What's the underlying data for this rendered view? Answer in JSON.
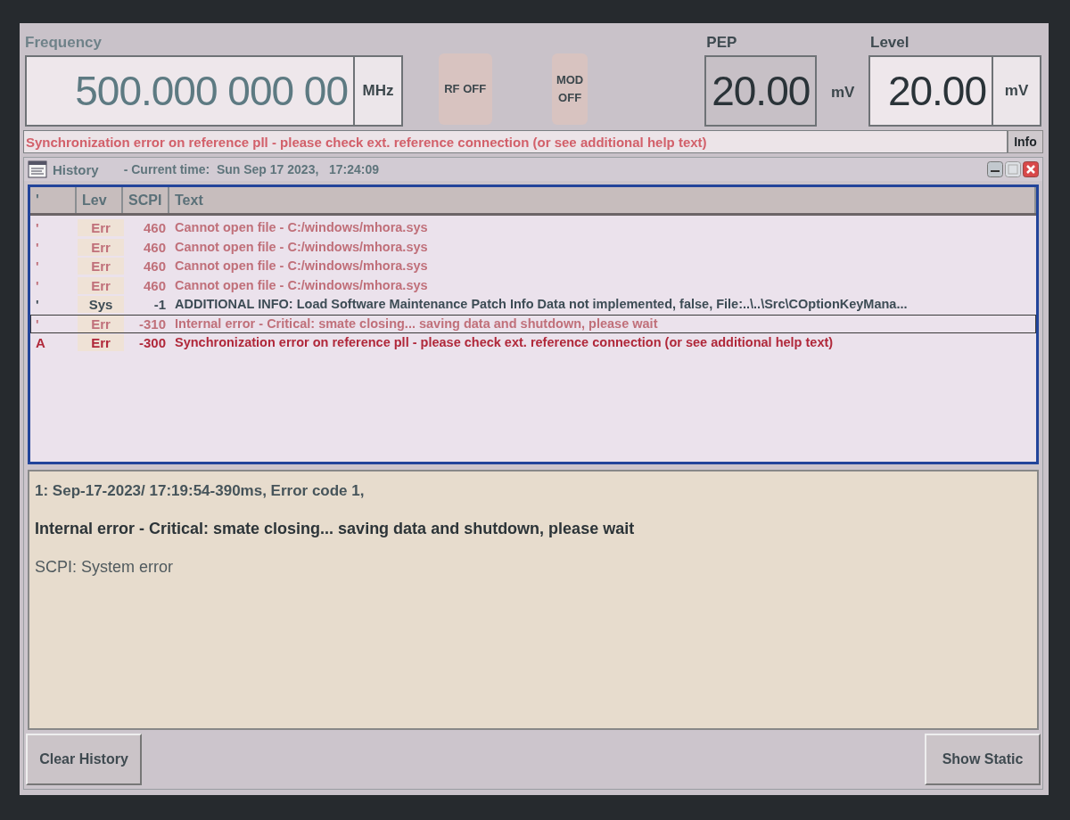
{
  "header": {
    "frequency": {
      "label": "Frequency",
      "value": "500.000 000 00",
      "unit": "MHz"
    },
    "rf_button": "RF OFF",
    "mod_button": "MOD OFF",
    "pep": {
      "label": "PEP",
      "value": "20.00",
      "unit": "mV"
    },
    "level": {
      "label": "Level",
      "value": "20.00",
      "unit": "mV"
    }
  },
  "status": {
    "message": "Synchronization error on reference pll - please check ext. reference connection (or see additional help text)",
    "info_button": "Info"
  },
  "history": {
    "title": "History",
    "current_time": "- Current time:  Sun Sep 17 2023,   17:24:09",
    "columns": [
      "'",
      "Lev",
      "SCPI",
      "Text"
    ],
    "rows": [
      {
        "mark": "'",
        "lev": "Err",
        "scpi": "460",
        "text": "Cannot open file - C:/windows/mhora.sys",
        "kind": "error",
        "selected": false,
        "active": false
      },
      {
        "mark": "'",
        "lev": "Err",
        "scpi": "460",
        "text": "Cannot open file - C:/windows/mhora.sys",
        "kind": "error",
        "selected": false,
        "active": false
      },
      {
        "mark": "'",
        "lev": "Err",
        "scpi": "460",
        "text": "Cannot open file - C:/windows/mhora.sys",
        "kind": "error",
        "selected": false,
        "active": false
      },
      {
        "mark": "'",
        "lev": "Err",
        "scpi": "460",
        "text": "Cannot open file - C:/windows/mhora.sys",
        "kind": "error",
        "selected": false,
        "active": false
      },
      {
        "mark": "'",
        "lev": "Sys",
        "scpi": "-1",
        "text": "ADDITIONAL INFO: Load Software Maintenance Patch Info Data not implemented, false, File:..\\..\\Src\\COptionKeyMana...",
        "kind": "system",
        "selected": false,
        "active": false
      },
      {
        "mark": "'",
        "lev": "Err",
        "scpi": "-310",
        "text": "Internal error - Critical: smate closing... saving data and shutdown, please wait",
        "kind": "error",
        "selected": true,
        "active": false
      },
      {
        "mark": "A",
        "lev": "Err",
        "scpi": "-300",
        "text": "Synchronization error on reference pll - please check ext. reference connection (or see additional help text)",
        "kind": "error",
        "selected": false,
        "active": true
      }
    ]
  },
  "detail": {
    "header": "1: Sep-17-2023/ 17:19:54-390ms, Error code 1,",
    "message": "Internal error - Critical: smate closing... saving data and shutdown, please wait",
    "scpi": "SCPI: System error"
  },
  "buttons": {
    "clear": "Clear History",
    "show": "Show Static"
  }
}
